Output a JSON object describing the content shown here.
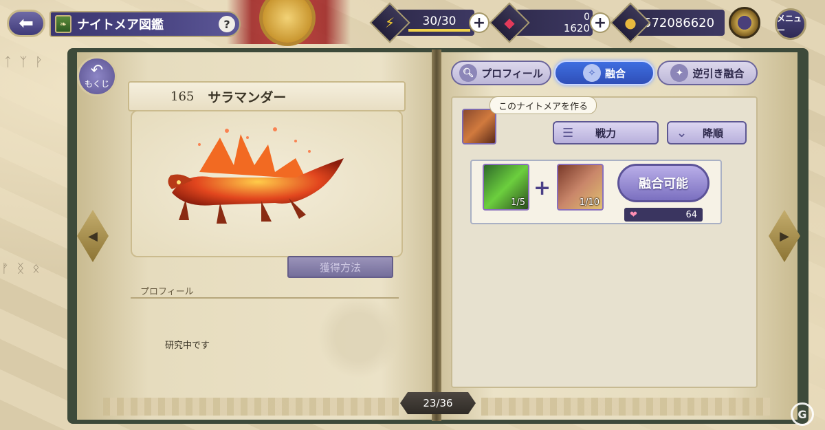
{
  "header": {
    "title": "ナイトメア図鑑",
    "help_label": "?",
    "stamina": "30/30",
    "gems_top": "0",
    "gems_bottom": "1620",
    "gold": "572086620",
    "menu_label": "メニュー",
    "plus_label": "+"
  },
  "left_page": {
    "back_label": "もくじ",
    "number": "165",
    "name": "サラマンダー",
    "acquire_button": "獲得方法",
    "profile_heading": "プロフィール",
    "profile_text": "研究中です",
    "page_indicator": "23/36"
  },
  "right_page": {
    "tabs": [
      {
        "label": "プロフィール",
        "active": false
      },
      {
        "label": "融合",
        "active": true
      },
      {
        "label": "逆引き融合",
        "active": false
      }
    ],
    "tooltip": "このナイトメアを作る",
    "sort_primary": "戦力",
    "sort_order": "降順",
    "fusion": {
      "material_1_count": "1/5",
      "material_2_count": "1/10",
      "plus": "+",
      "fuse_button": "融合可能",
      "cost": "64"
    }
  },
  "icons": [
    "back-arrow-icon",
    "book-icon",
    "lightning-icon",
    "gem-icon",
    "gold-coin-icon",
    "gear-icon",
    "heart-icon",
    "sort-lines-icon",
    "chevron-down-icon",
    "magnifier-icon"
  ],
  "colors": {
    "accent": "#3e6ee0",
    "panel": "#3b3670",
    "paper": "#ebe2c7"
  }
}
